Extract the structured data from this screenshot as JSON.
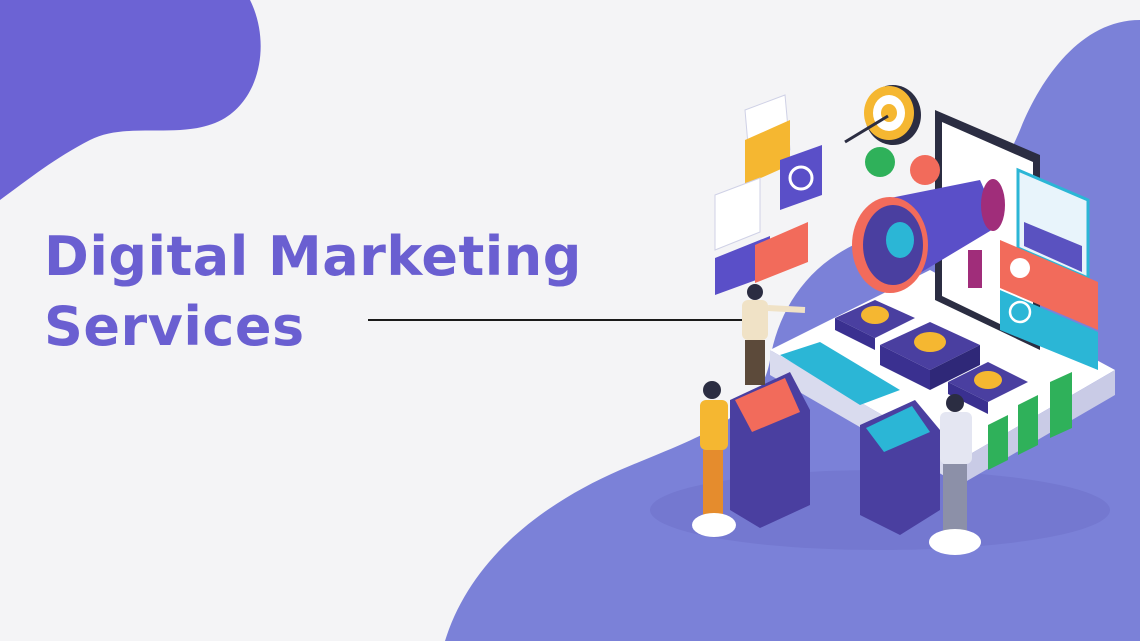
{
  "headline": {
    "line1": "Digital Marketing",
    "line2": "Services"
  },
  "colors": {
    "page_background": "#f4f4f6",
    "blob_primary": "#7b81d8",
    "blob_corner": "#6c63d4",
    "headline_text": "#6a5fd1",
    "accent_red": "#f26b5b",
    "accent_gold": "#f5b731",
    "accent_green": "#2fb15a",
    "accent_cyan": "#2bb6d6",
    "panel_purple": "#4a3fa0"
  },
  "illustration": {
    "icons": [
      "target-icon",
      "megaphone-icon",
      "email-icon",
      "at-sign-icon",
      "chat-bubble-icon",
      "like-icon",
      "coin-icon",
      "globe-icon",
      "user-profile-icon",
      "bar-chart-icon"
    ]
  }
}
